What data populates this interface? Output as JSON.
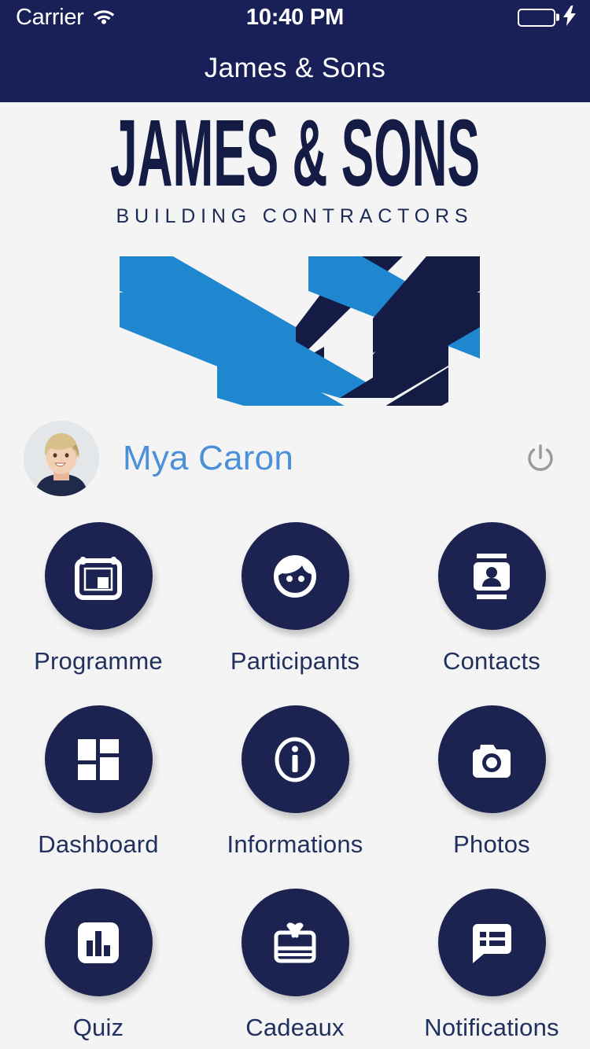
{
  "status_bar": {
    "carrier": "Carrier",
    "wifi_icon": "wifi-icon",
    "time": "10:40 PM",
    "battery_icon": "battery-icon",
    "battery_color": "#4bd762",
    "charging_icon": "lightning-bolt-icon"
  },
  "nav": {
    "title": "James & Sons",
    "background": "#192057"
  },
  "logo": {
    "wordmark_line1": "JAMES & SONS",
    "wordmark_line2": "BUILDING CONTRACTORS",
    "mark_name": "isometric-chevron-logo-mark",
    "color_dark": "#141c46",
    "color_light": "#1f87d0"
  },
  "user": {
    "name": "Mya Caron",
    "name_color": "#4c90d9",
    "avatar_name": "user-avatar-photo",
    "logout_icon": "power-icon"
  },
  "menu": {
    "circle_color": "#1c2350",
    "label_color": "#21305e",
    "items": [
      {
        "label": "Programme",
        "icon": "calendar-icon"
      },
      {
        "label": "Participants",
        "icon": "face-icon"
      },
      {
        "label": "Contacts",
        "icon": "contact-card-icon"
      },
      {
        "label": "Dashboard",
        "icon": "grid-tiles-icon"
      },
      {
        "label": "Informations",
        "icon": "info-circle-icon"
      },
      {
        "label": "Photos",
        "icon": "camera-icon"
      },
      {
        "label": "Quiz",
        "icon": "bar-chart-icon"
      },
      {
        "label": "Cadeaux",
        "icon": "gift-icon"
      },
      {
        "label": "Notifications",
        "icon": "speech-bubble-list-icon"
      }
    ]
  }
}
